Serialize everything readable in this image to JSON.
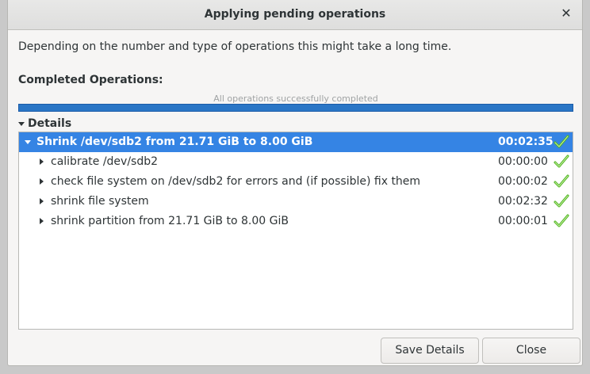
{
  "dialog": {
    "title": "Applying pending operations",
    "close_icon": "close-icon",
    "description": "Depending on the number and type of operations this might take a long time.",
    "completed_label": "Completed Operations:",
    "progress_text": "All operations successfully completed",
    "progress_fraction": 1.0,
    "details_label": "Details",
    "accent_color": "#3584e4",
    "check_color": "#4db321"
  },
  "tree": {
    "parent": {
      "label": "Shrink /dev/sdb2 from 21.71 GiB to 8.00 GiB",
      "time": "00:02:35",
      "status_icon": "checkmark-icon"
    },
    "children": [
      {
        "label": "calibrate /dev/sdb2",
        "time": "00:00:00",
        "status_icon": "checkmark-icon"
      },
      {
        "label": "check file system on /dev/sdb2 for errors and (if possible) fix them",
        "time": "00:00:02",
        "status_icon": "checkmark-icon"
      },
      {
        "label": "shrink file system",
        "time": "00:02:32",
        "status_icon": "checkmark-icon"
      },
      {
        "label": "shrink partition from 21.71 GiB to 8.00 GiB",
        "time": "00:00:01",
        "status_icon": "checkmark-icon"
      }
    ]
  },
  "buttons": {
    "save_details": "Save Details",
    "close": "Close"
  }
}
